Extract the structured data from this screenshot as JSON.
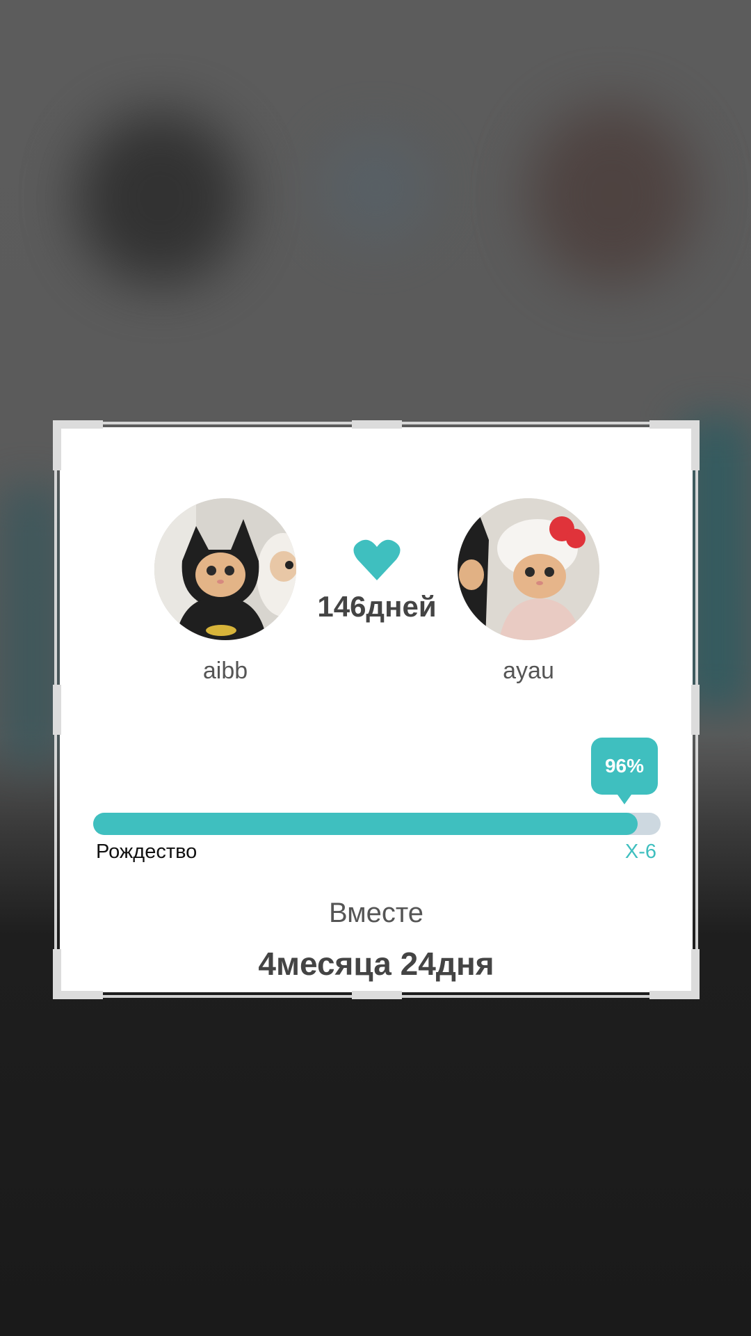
{
  "profiles": {
    "left": {
      "name": "aibb",
      "avatar_icon": "cat-batman-avatar"
    },
    "right": {
      "name": "ayau",
      "avatar_icon": "cat-hello-kitty-avatar"
    }
  },
  "relationship": {
    "days_label": "146дней",
    "heart_icon": "heart-icon",
    "together_label": "Вместе",
    "duration_label": "4месяца 24дня"
  },
  "progress": {
    "percent_label": "96%",
    "percent_value": 0.96,
    "start_label": "Рождество",
    "end_label": "X-6"
  },
  "colors": {
    "accent": "#3fbfbf",
    "track": "#cdd8e0"
  }
}
